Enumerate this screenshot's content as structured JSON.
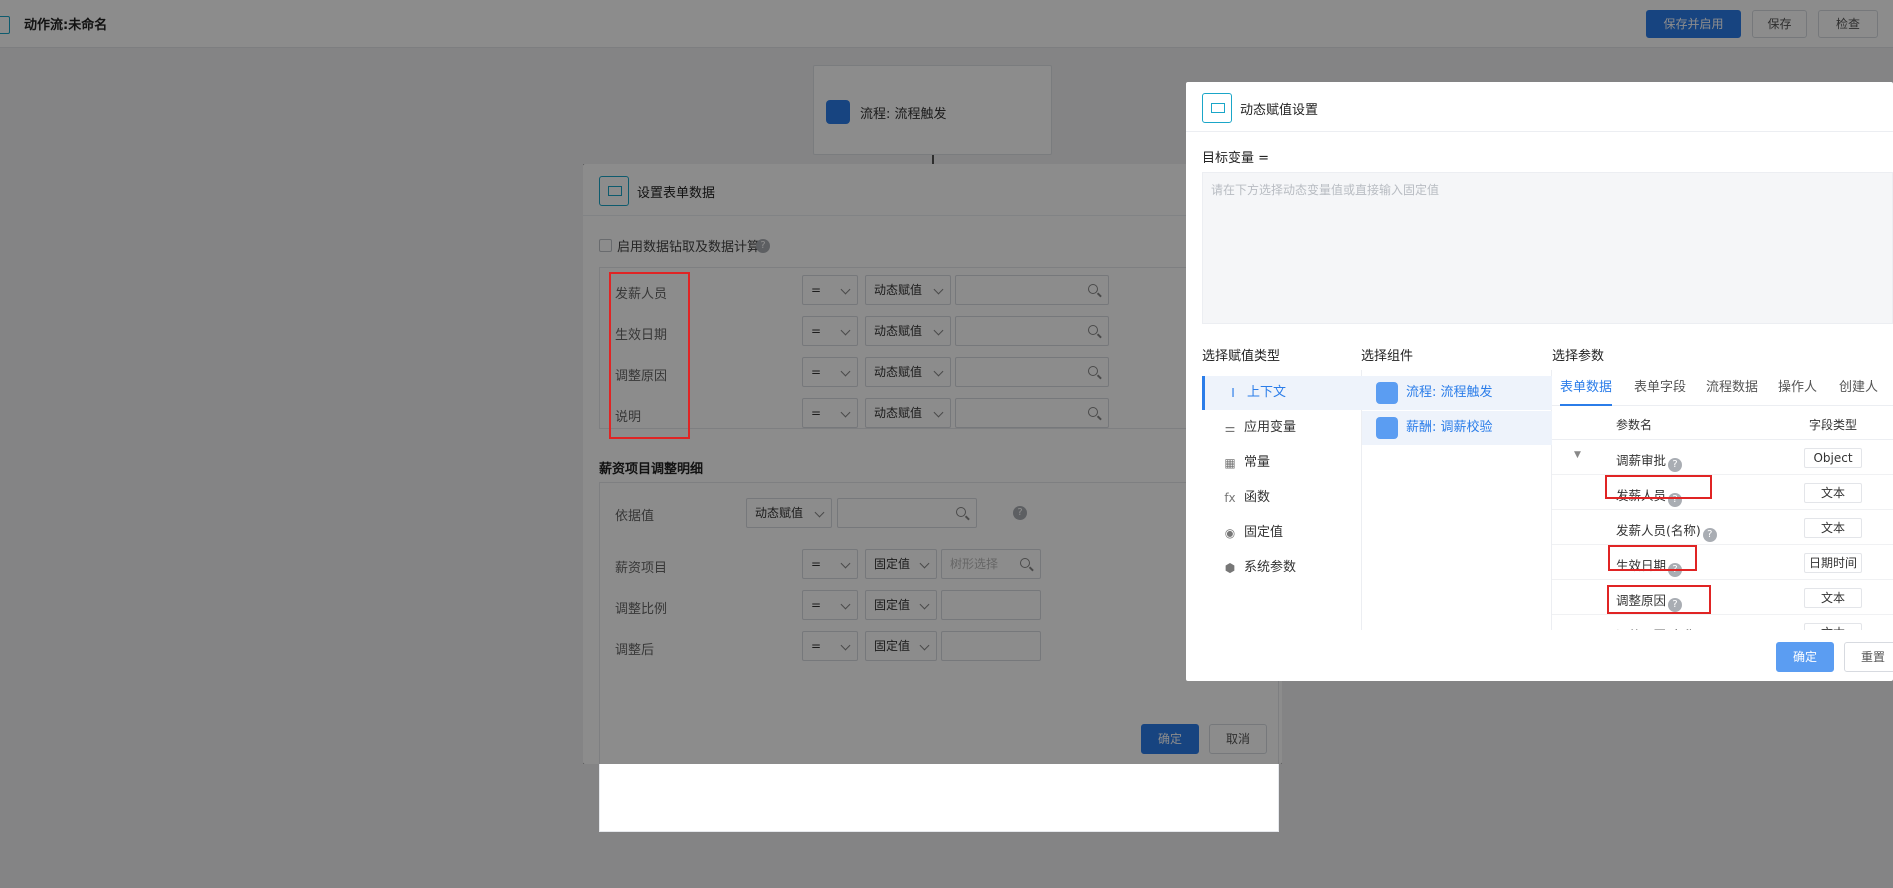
{
  "header": {
    "title": "动作流:未命名",
    "save_enable": "保存并启用",
    "save": "保存",
    "check": "检查"
  },
  "canvas": {
    "node_label": "流程: 流程触发"
  },
  "form_dialog": {
    "title": "设置表单数据",
    "enable_checkbox": "启用数据钻取及数据计算",
    "fields": [
      {
        "label": "发薪人员",
        "op": "=",
        "mode": "动态赋值"
      },
      {
        "label": "生效日期",
        "op": "=",
        "mode": "动态赋值"
      },
      {
        "label": "调整原因",
        "op": "=",
        "mode": "动态赋值"
      },
      {
        "label": "说明",
        "op": "=",
        "mode": "动态赋值"
      }
    ],
    "detail_title": "薪资项目调整明细",
    "basis_label": "依据值",
    "basis_mode": "动态赋值",
    "detail_fields": [
      {
        "label": "薪资项目",
        "op": "=",
        "mode": "固定值",
        "placeholder": "树形选择"
      },
      {
        "label": "调整比例",
        "op": "=",
        "mode": "固定值",
        "placeholder": ""
      },
      {
        "label": "调整后",
        "op": "=",
        "mode": "固定值",
        "placeholder": ""
      }
    ],
    "ok": "确定",
    "cancel": "取消"
  },
  "dynamic_dialog": {
    "title": "动态赋值设置",
    "target_label": "目标变量 =",
    "target_placeholder": "请在下方选择动态变量值或直接输入固定值",
    "col1_title": "选择赋值类型",
    "col2_title": "选择组件",
    "col3_title": "选择参数",
    "types": [
      {
        "label": "上下文",
        "icon": "context-icon",
        "glyph": "I"
      },
      {
        "label": "应用变量",
        "icon": "app-variable-icon",
        "glyph": "⚌"
      },
      {
        "label": "常量",
        "icon": "constant-icon",
        "glyph": "▦"
      },
      {
        "label": "函数",
        "icon": "function-icon",
        "glyph": "fx"
      },
      {
        "label": "固定值",
        "icon": "fixed-value-icon",
        "glyph": "◉"
      },
      {
        "label": "系统参数",
        "icon": "system-param-icon",
        "glyph": "⬢"
      }
    ],
    "components": [
      {
        "label": "流程: 流程触发",
        "icon": "flow-icon"
      },
      {
        "label": "薪酬: 调薪校验",
        "icon": "salary-icon"
      }
    ],
    "tabs": [
      "表单数据",
      "表单字段",
      "流程数据",
      "操作人",
      "创建人"
    ],
    "param_header": {
      "name": "参数名",
      "type": "字段类型"
    },
    "params": [
      {
        "name": "调薪审批",
        "type": "Object",
        "help": true,
        "indent": false
      },
      {
        "name": "发薪人员",
        "type": "文本",
        "help": true,
        "indent": true
      },
      {
        "name": "发薪人员(名称)",
        "type": "文本",
        "help": true,
        "indent": true
      },
      {
        "name": "生效日期",
        "type": "日期时间",
        "help": true,
        "indent": true
      },
      {
        "name": "调整原因",
        "type": "文本",
        "help": true,
        "indent": true
      },
      {
        "name": "调整原因(名称)",
        "type": "文本",
        "help": true,
        "indent": true
      }
    ],
    "ok": "确定",
    "reset": "重置"
  },
  "colors": {
    "primary": "#2b7de9",
    "accent_teal": "#1aa6c8",
    "highlight_red": "#e02424"
  }
}
